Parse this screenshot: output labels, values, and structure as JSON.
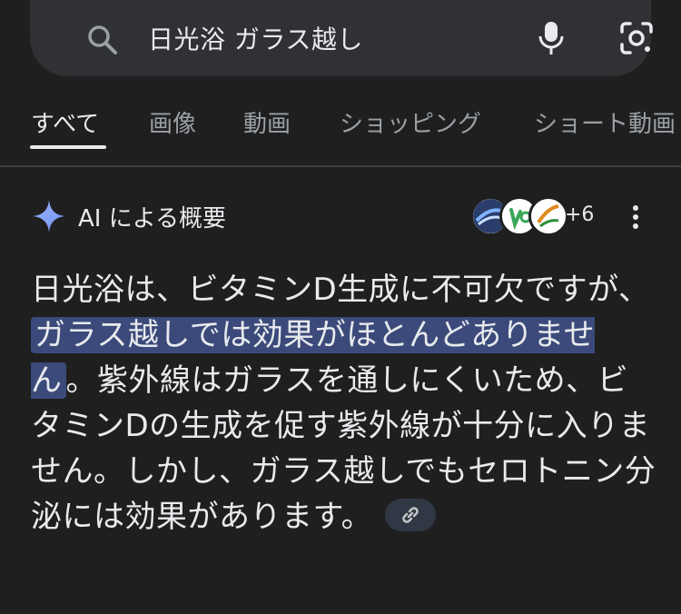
{
  "search": {
    "query": "日光浴 ガラス越し",
    "icons": [
      "search-icon",
      "mic-icon",
      "camera-lens-icon"
    ]
  },
  "tabs": [
    {
      "label": "すべて",
      "active": true
    },
    {
      "label": "画像",
      "active": false
    },
    {
      "label": "動画",
      "active": false
    },
    {
      "label": "ショッピング",
      "active": false
    },
    {
      "label": "ショート動画",
      "active": false
    }
  ],
  "ai_overview": {
    "title": "AI による概要",
    "sources_more": "+6",
    "text_before": "日光浴は、ビタミンD生成に不可欠ですが、",
    "text_highlight": "ガラス越しでは効果がほとんどありません",
    "text_after": "。紫外線はガラスを通しにくいため、ビタミンDの生成を促す紫外線が十分に入りません。しかし、ガラス越しでもセロトニン分泌には効果があります。"
  },
  "colors": {
    "background": "#1f1f1f",
    "search_bg": "#303134",
    "highlight": "#3b4a7a",
    "sparkle": "#8ab4f8"
  }
}
